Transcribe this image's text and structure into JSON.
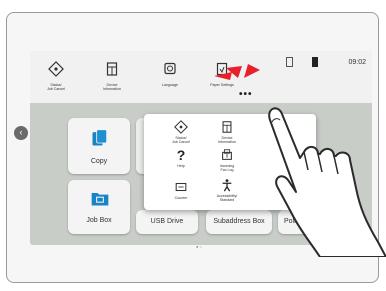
{
  "topbar": {
    "status_job_cancel": "Status/\nJob Cancel",
    "device_information": "Device\nInformation",
    "language": "Language",
    "paper_settings": "Paper Settings",
    "clock": "09:02",
    "more": "•••"
  },
  "tiles": [
    {
      "label": "Copy"
    },
    {
      "label": "Job Box"
    },
    {
      "label": "USB Drive"
    },
    {
      "label": "Subaddress Box"
    },
    {
      "label": "Polling"
    }
  ],
  "popup": {
    "items": [
      {
        "label": "Status/\nJob Cancel"
      },
      {
        "label": "Device\nInformation"
      },
      {
        "label": "Help"
      },
      {
        "label": "Incoming\nFax Log"
      },
      {
        "label": "Counter"
      },
      {
        "label": "Accessibility/\nStandard"
      }
    ]
  },
  "icons": {
    "status": "radar-icon",
    "device_info": "device-info-icon",
    "language": "globe-icon",
    "paper": "paper-icon",
    "help": "question-icon",
    "fax_log": "fax-log-icon",
    "counter": "counter-icon",
    "accessibility": "person-icon"
  },
  "colors": {
    "accent_blue": "#1a83c6",
    "burst_red": "#e8202a"
  }
}
